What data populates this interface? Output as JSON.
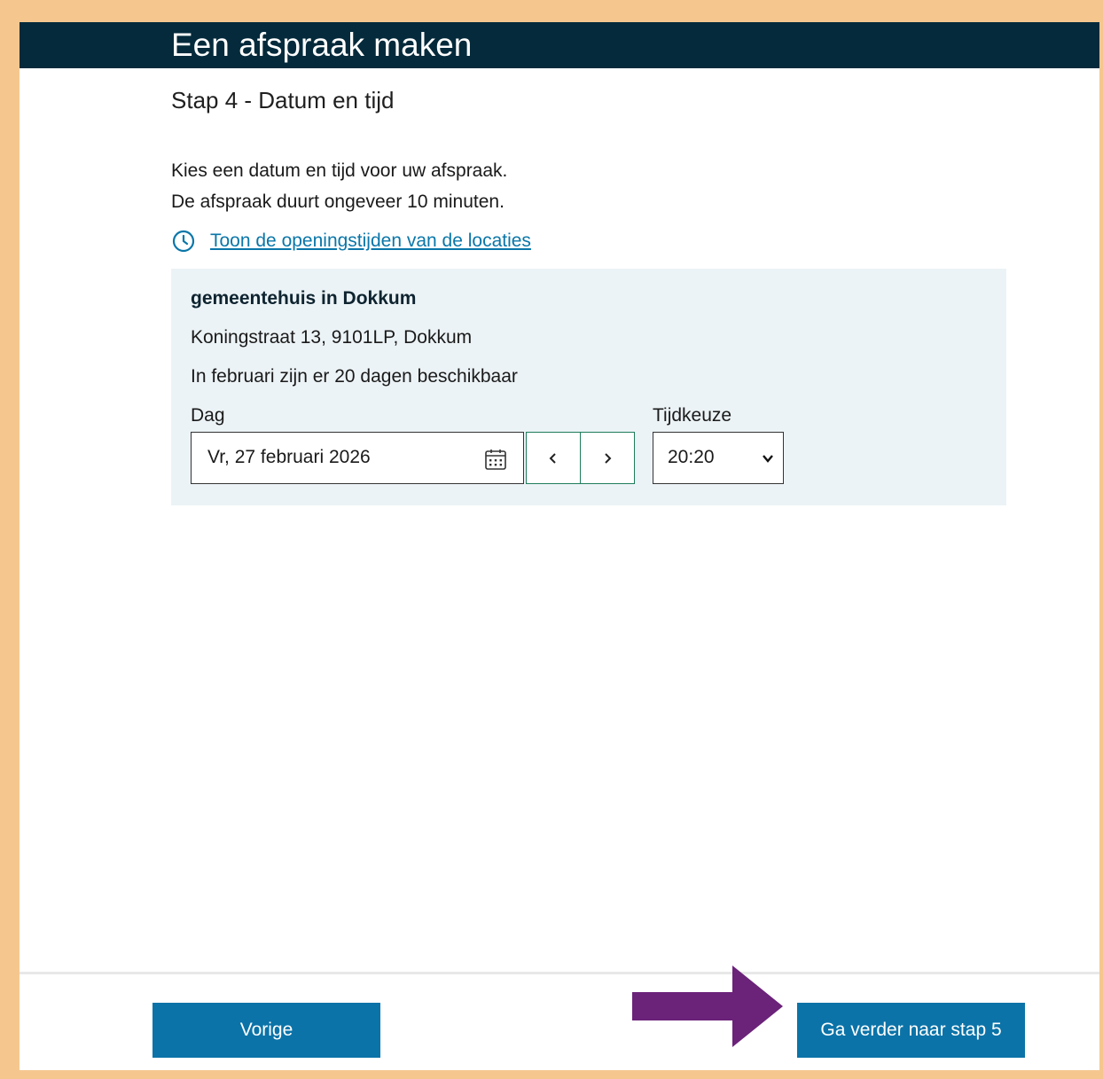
{
  "header": {
    "title": "Een afspraak maken"
  },
  "step": {
    "title": "Stap 4 - Datum en tijd"
  },
  "intro": {
    "line1": "Kies een datum en tijd voor uw afspraak.",
    "line2": "De afspraak duurt ongeveer 10 minuten."
  },
  "hours_link": {
    "label": "Toon de openingstijden van de locaties",
    "icon": "clock-icon"
  },
  "location": {
    "name": "gemeentehuis in Dokkum",
    "address": "Koningstraat 13, 9101LP, Dokkum",
    "availability": "In februari zijn er 20 dagen beschikbaar"
  },
  "date": {
    "label": "Dag",
    "value": "Vr, 27 februari 2026",
    "calendar_icon": "calendar-icon",
    "prev_icon": "chevron-left-icon",
    "next_icon": "chevron-right-icon"
  },
  "time": {
    "label": "Tijdkeuze",
    "value": "20:20",
    "icon": "chevron-down-icon"
  },
  "footer": {
    "prev_label": "Vorige",
    "next_label": "Ga verder naar stap 5"
  },
  "annotation": {
    "icon": "arrow-right-icon",
    "color": "#6b2279"
  },
  "colors": {
    "header_bg": "#042a3b",
    "primary_button": "#0b73a8",
    "link": "#0a76a9",
    "panel_bg": "#ecf3f6",
    "nav_border": "#1e7d5a",
    "page_border": "#f5c78f"
  }
}
